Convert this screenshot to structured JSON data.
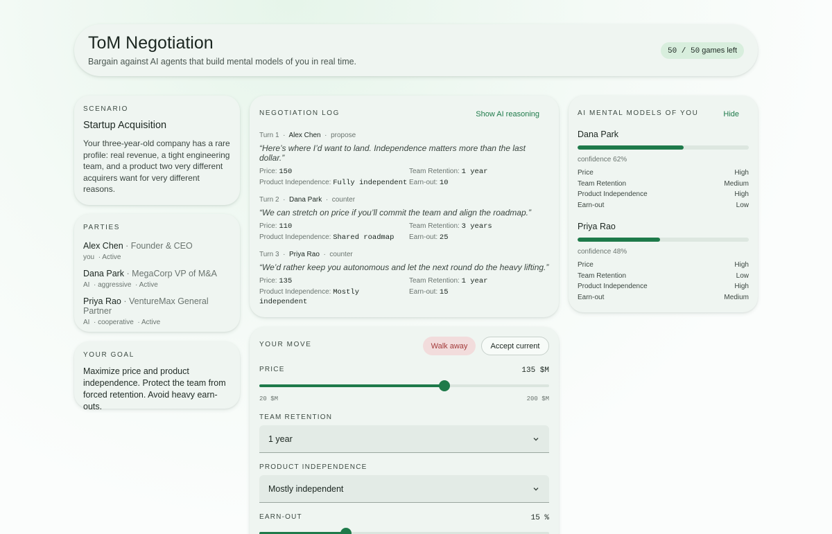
{
  "header": {
    "title": "ToM Negotiation",
    "subtitle": "Bargain against AI agents that build mental models of you in real time.",
    "games_count": "50 / 50",
    "games_suffix": "games left"
  },
  "scenario": {
    "label": "SCENARIO",
    "title": "Startup Acquisition",
    "body": "Your three-year-old company has a rare profile: real revenue, a tight engineering team, and a product two very different acquirers want for very different reasons."
  },
  "parties": {
    "label": "PARTIES",
    "items": [
      {
        "name": "Alex Chen",
        "role": "· Founder & CEO",
        "type": "you",
        "stance": "",
        "status": "· Active"
      },
      {
        "name": "Dana Park",
        "role": "· MegaCorp VP of M&A",
        "type": "AI",
        "stance": "· aggressive",
        "status": "· Active"
      },
      {
        "name": "Priya Rao",
        "role": "· VentureMax General Partner",
        "type": "AI",
        "stance": "· cooperative",
        "status": "· Active"
      }
    ]
  },
  "goal": {
    "label": "YOUR GOAL",
    "text": "Maximize price and product independence. Protect the team from forced retention. Avoid heavy earn-outs."
  },
  "log": {
    "label": "NEGOTIATION LOG",
    "toggle": "Show AI reasoning",
    "sep": "·",
    "turns": [
      {
        "turn": "Turn 1",
        "who": "Alex Chen",
        "action": "propose",
        "quote": "“Here’s where I’d want to land. Independence matters more than the last dollar.”",
        "price_label": "Price:",
        "price": "150",
        "retention_label": "Team Retention:",
        "retention": "1 year",
        "independence_label": "Product Independence:",
        "independence": "Fully independent",
        "earnout_label": "Earn-out:",
        "earnout": "10"
      },
      {
        "turn": "Turn 2",
        "who": "Dana Park",
        "action": "counter",
        "quote": "“We can stretch on price if you’ll commit the team and align the roadmap.”",
        "price_label": "Price:",
        "price": "110",
        "retention_label": "Team Retention:",
        "retention": "3 years",
        "independence_label": "Product Independence:",
        "independence": "Shared roadmap",
        "earnout_label": "Earn-out:",
        "earnout": "25"
      },
      {
        "turn": "Turn 3",
        "who": "Priya Rao",
        "action": "counter",
        "quote": "“We’d rather keep you autonomous and let the next round do the heavy lifting.”",
        "price_label": "Price:",
        "price": "135",
        "retention_label": "Team Retention:",
        "retention": "1 year",
        "independence_label": "Product Independence:",
        "independence": "Mostly independent",
        "earnout_label": "Earn-out:",
        "earnout": "15"
      }
    ]
  },
  "models": {
    "label": "AI MENTAL MODELS OF YOU",
    "toggle": "Hide",
    "items": [
      {
        "name": "Dana Park",
        "confidence": 0.62,
        "confidence_text": "confidence 62%",
        "beliefs": [
          {
            "issue": "Price",
            "level": "High"
          },
          {
            "issue": "Team Retention",
            "level": "Medium"
          },
          {
            "issue": "Product Independence",
            "level": "High"
          },
          {
            "issue": "Earn-out",
            "level": "Low"
          }
        ]
      },
      {
        "name": "Priya Rao",
        "confidence": 0.48,
        "confidence_text": "confidence 48%",
        "beliefs": [
          {
            "issue": "Price",
            "level": "High"
          },
          {
            "issue": "Team Retention",
            "level": "Low"
          },
          {
            "issue": "Product Independence",
            "level": "High"
          },
          {
            "issue": "Earn-out",
            "level": "Medium"
          }
        ]
      }
    ]
  },
  "move": {
    "label": "YOUR MOVE",
    "walk_away": "Walk away",
    "accept": "Accept current",
    "price": {
      "label": "PRICE",
      "value": 135,
      "value_text": "135 $M",
      "min": 20,
      "max": 200,
      "min_text": "20 $M",
      "max_text": "200 $M"
    },
    "retention": {
      "label": "TEAM RETENTION",
      "selected": "1 year"
    },
    "independence": {
      "label": "PRODUCT INDEPENDENCE",
      "selected": "Mostly independent"
    },
    "earnout": {
      "label": "EARN-OUT",
      "value": 15,
      "value_text": "15 %",
      "min": 0,
      "max": 50
    }
  },
  "colors": {
    "accent": "#1e7a4a",
    "walk_bg": "#f2dcdc",
    "walk_text": "#a33a3a"
  }
}
